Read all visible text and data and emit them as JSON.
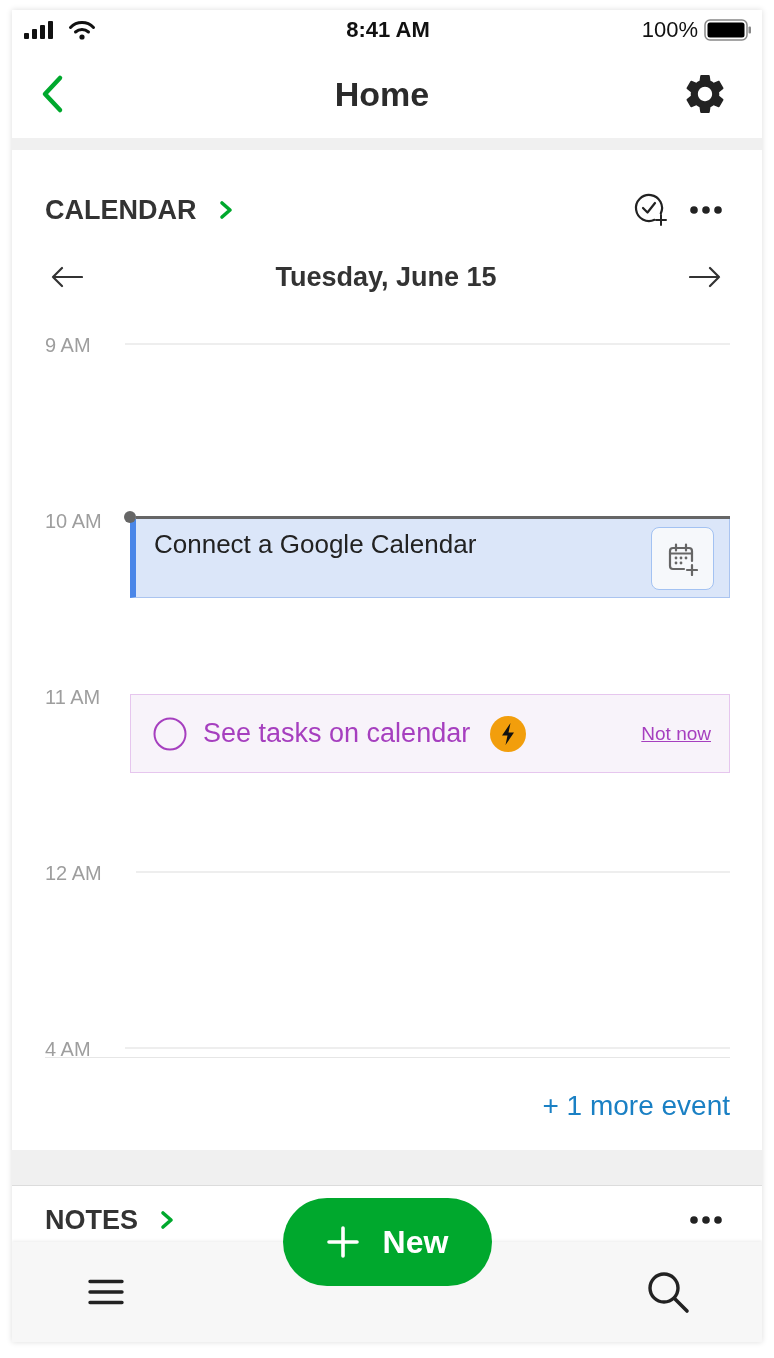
{
  "status_bar": {
    "time": "8:41 AM",
    "battery": "100%"
  },
  "nav_bar": {
    "title": "Home"
  },
  "calendar": {
    "title": "CALENDAR",
    "date": "Tuesday, June 15",
    "hours": [
      {
        "label": "9 AM",
        "kind": "empty",
        "current_time": false
      },
      {
        "label": "10 AM",
        "kind": "event",
        "current_time": true,
        "event": {
          "title": "Connect a Google Calendar"
        }
      },
      {
        "label": "11 AM",
        "kind": "task",
        "current_time": false,
        "task": {
          "title": "See tasks on calendar",
          "checked": false,
          "dismiss": "Not now"
        }
      },
      {
        "label": "12 AM",
        "kind": "empty",
        "current_time": false
      },
      {
        "label": "4 AM",
        "kind": "empty",
        "current_time": false
      }
    ],
    "more_events": "+ 1 more event"
  },
  "notes": {
    "title": "NOTES"
  },
  "fab": {
    "label": "New"
  }
}
